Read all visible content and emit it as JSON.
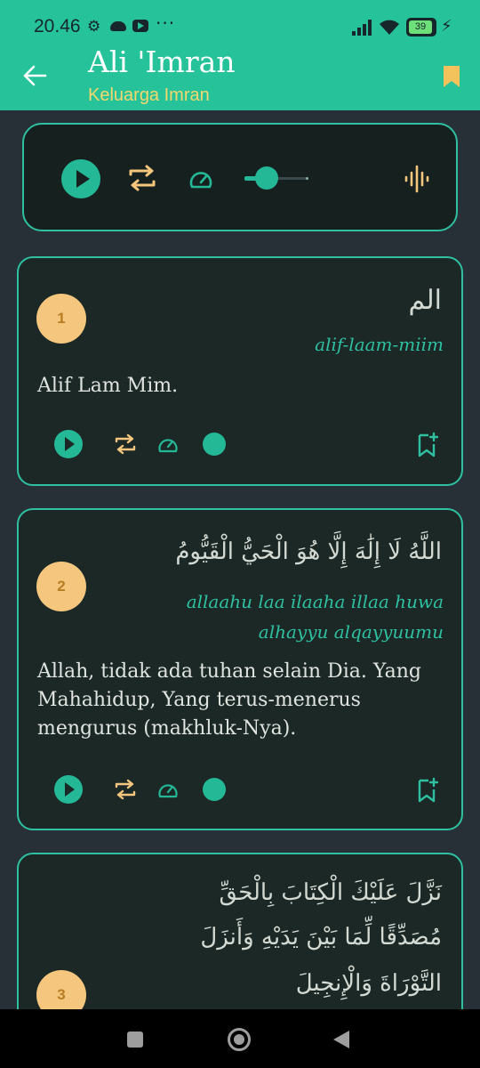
{
  "status_bar": {
    "time": "20.46",
    "more": "···",
    "battery": "39"
  },
  "header": {
    "title": "Ali 'Imran",
    "subtitle": "Keluarga Imran"
  },
  "colors": {
    "accent": "#26c39b",
    "gold": "#f5c77e",
    "card_bg": "#1b2826",
    "background": "#263036"
  },
  "player": {
    "volume": 0.35
  },
  "verses": [
    {
      "number": "1",
      "arabic": "الم",
      "translit": "alif-laam-miim",
      "translation": "Alif Lam Mim."
    },
    {
      "number": "2",
      "arabic": "اللَّهُ لَا إِلَٰهَ إِلَّا هُوَ الْحَيُّ الْقَيُّومُ",
      "translit_lines": [
        "allaahu laa ilaaha illaa huwa",
        "alhayyu alqayyuumu"
      ],
      "translation_lines": [
        "Allah, tidak ada tuhan selain Dia. Yang",
        "Mahahidup, Yang terus-menerus",
        "mengurus (makhluk-Nya)."
      ]
    },
    {
      "number": "3",
      "arabic_lines": [
        "نَزَّلَ عَلَيْكَ الْكِتَابَ بِالْحَقِّ",
        "مُصَدِّقًا لِّمَا بَيْنَ يَدَيْهِ وَأَنزَلَ",
        "التَّوْرَاةَ وَالْإِنجِيلَ"
      ]
    }
  ]
}
